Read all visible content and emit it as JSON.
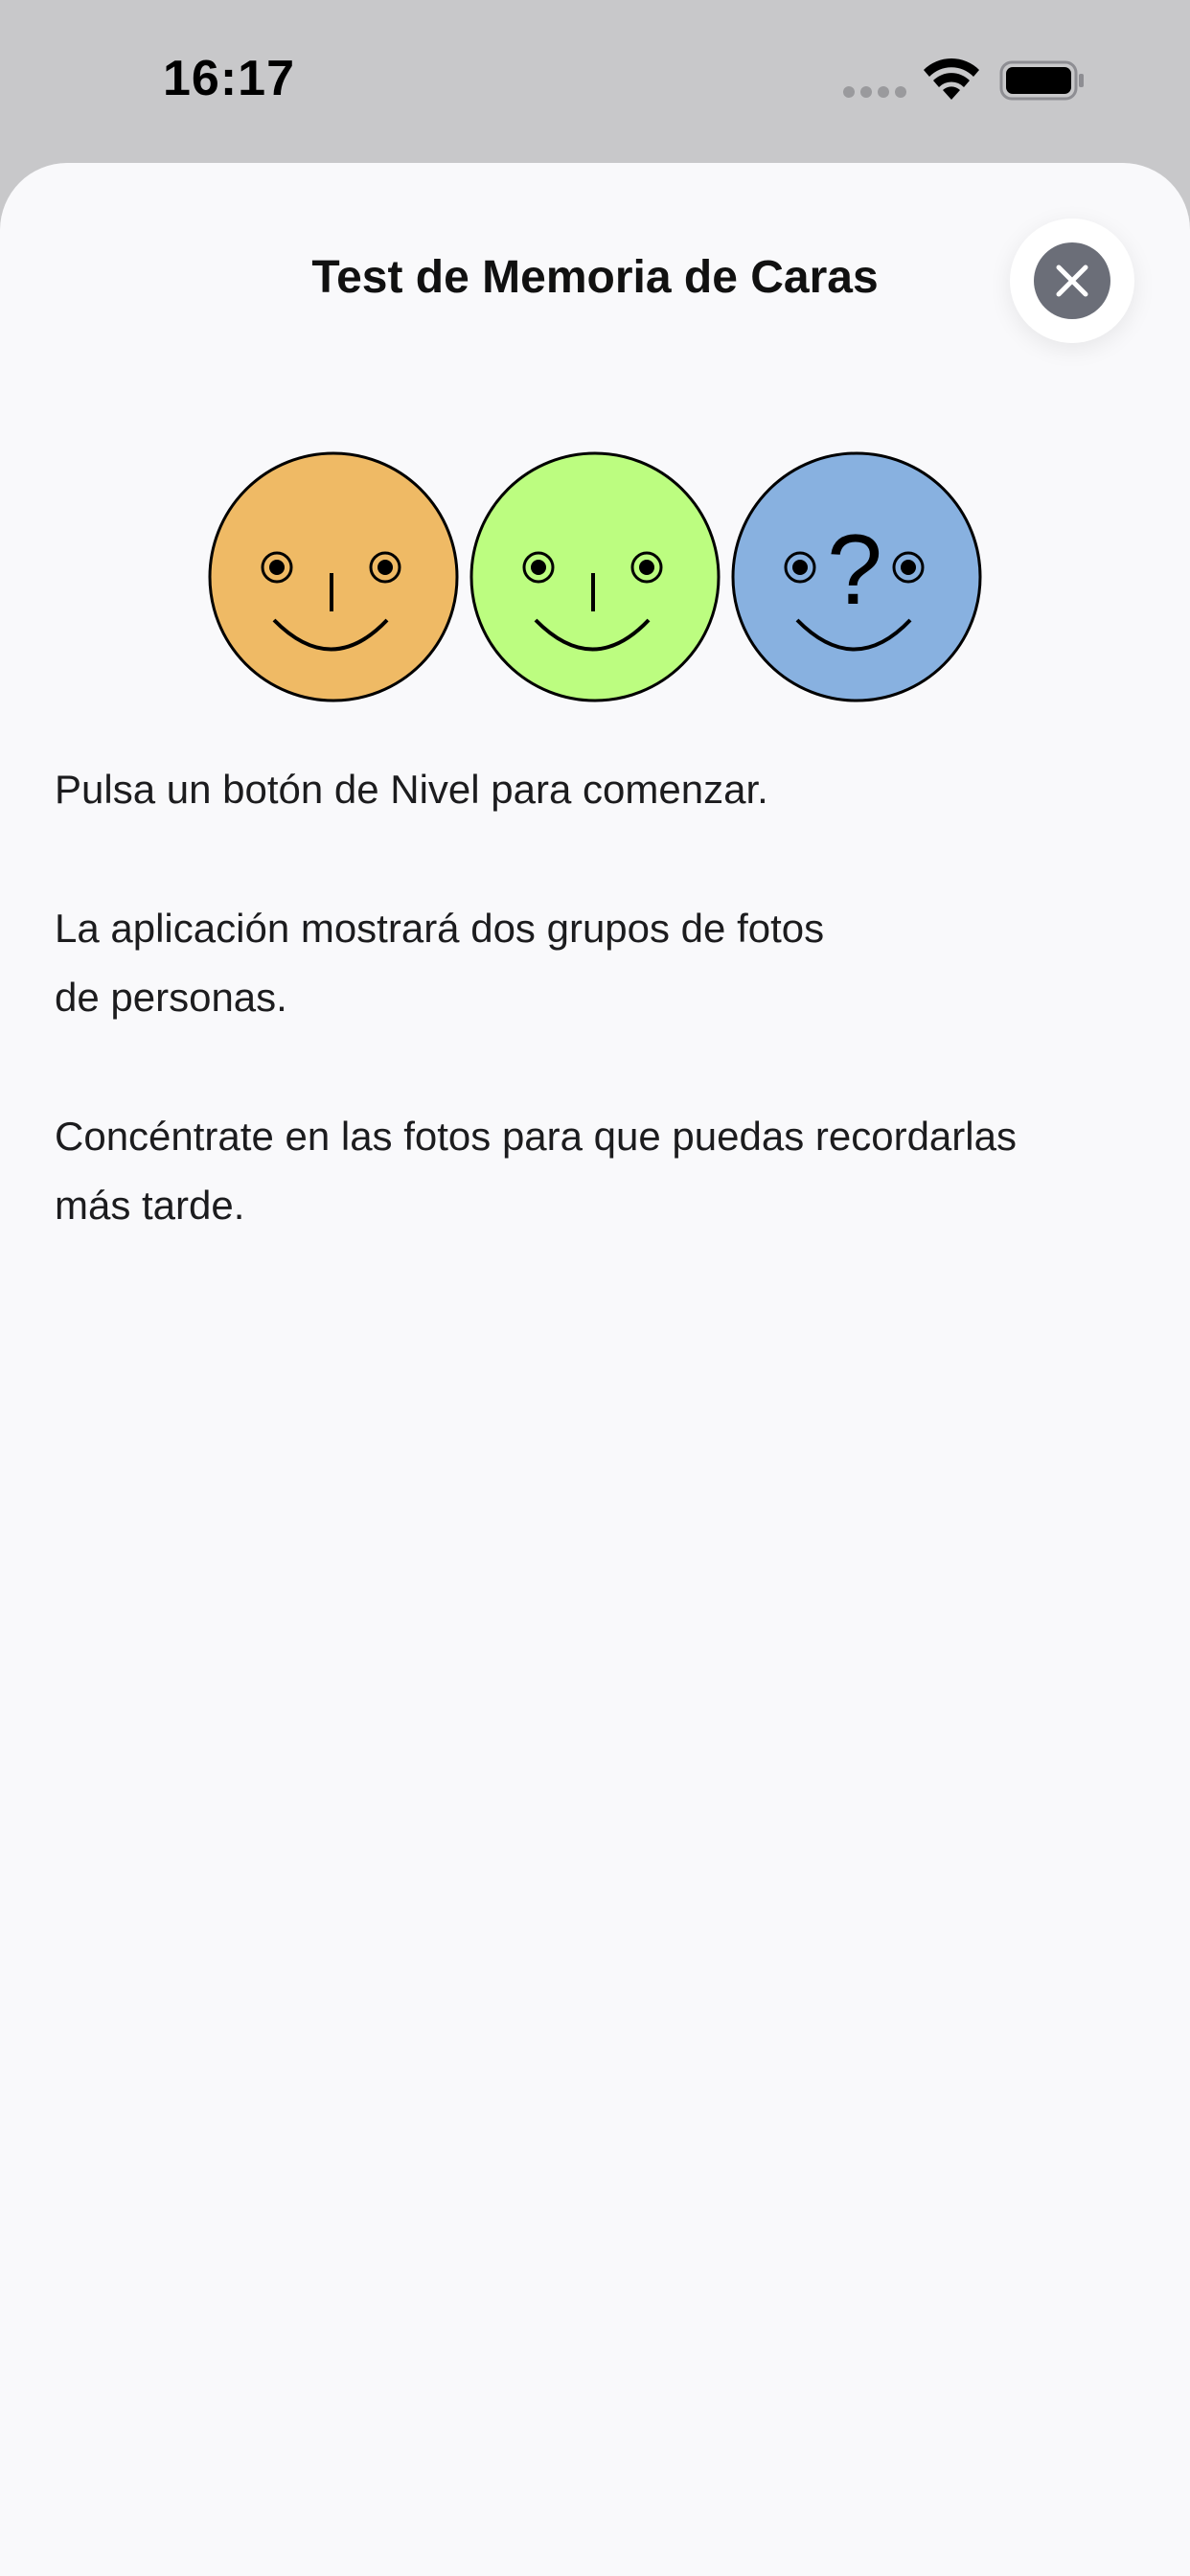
{
  "status_bar": {
    "time": "16:17",
    "icons": [
      "cellular-signal-icon",
      "wifi-icon",
      "battery-icon"
    ]
  },
  "sheet": {
    "title": "Test de Memoria de Caras",
    "close_icon": "close-icon"
  },
  "faces": [
    {
      "name": "orange-smiley-face",
      "color": "#efba65"
    },
    {
      "name": "green-smiley-face",
      "color": "#bcfd80"
    },
    {
      "name": "blue-question-face",
      "color": "#88b1e0",
      "mark": "?"
    }
  ],
  "instructions": {
    "p1": "Pulsa un botón de Nivel para comenzar.",
    "p2": "La aplicación mostrará dos grupos de fotos\nde personas.",
    "p3": "Concéntrate en las fotos para que puedas recordarlas\nmás tarde."
  },
  "colors": {
    "background_top": "#c8c8ca",
    "sheet": "#f9f9fb",
    "close_button": "#6b6e78"
  }
}
